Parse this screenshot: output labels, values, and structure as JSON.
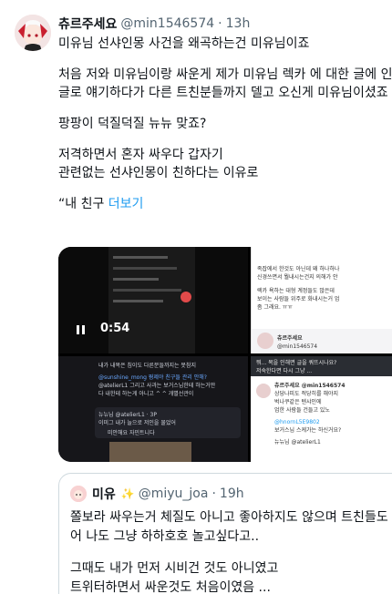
{
  "tweet": {
    "author_name": "츄르주세요",
    "author_handle": "@min1546574",
    "separator": "·",
    "time": "13h",
    "lines": [
      "미유님 선샤인몽 사건을 왜곡하는건 미유님이죠",
      "처음 저와 미유님이랑 싸운게 제가 미유님 렉카 에 대한 글에 인용",
      "글로 얘기하다가 다른 트친분들까지 델고 오신게 미유님이셨죠",
      "팡팡이 덕질덕질 뉴뉴 맞죠?",
      "저격하면서 혼자 싸우다 갑자기",
      "관련없는 선샤인몽이 친하다는 이유로"
    ],
    "last_line_prefix": "“내 친구 ",
    "last_line_mention": "더보기"
  },
  "media": {
    "video_duration": "0:54",
    "panel_top_right": [
      "족잡에서 한것도 아닌데 왜 하나하나",
      "신경쓰면서 뭘내시는건지 의해가 안",
      "렉카 욕하는 대형 계정들도 많은데",
      "보이는 사람들 위주로 화내시는거 엄",
      "좀 그래요. ㅠㅠ"
    ],
    "panel_top_right_name": "츄르주세요",
    "panel_top_right_handle": "@min1546574",
    "panel_bottom_left": [
      "내가 내목은 침이도 다른분들까지는 못참지",
      "@sunshine_mong 뭥제야 친구들 관리 안해?",
      "@atelierL1 그리고 사과는 보거스님한테 하는거만",
      "다 내한테 하는게 아니고 ^ ^ 개별선관이"
    ],
    "panel_bottom_left_reply": "뉴뉴님 @atelierL1 · 3P",
    "panel_bottom_left_reply_text": "이미그 내가 늘으로 저인을 물었어",
    "panel_bottom_left_note": "미안해요 자민트니다",
    "panel_bottom_right": [
      "뭐... 목을 인해면 글을 쿼뜨시나요?",
      "저숙한다면 다시 그냥 ...",
      "츄르주세요 @min1546574",
      "상당나피도 적당히를 해야지",
      "벅나쿠같은 텐샤인에",
      "엄한 사람들 건들고 있노",
      "@hnornL5E9802",
      "보거스님 스케가는 하신거요?",
      "뉴뉴님 @atelierL1"
    ]
  },
  "quote": {
    "author_name": "미유",
    "author_handle": "@miyu_joa",
    "separator": "·",
    "time": "19h",
    "lines": [
      "쫄보라 싸우는거 체질도 아니고 좋아하지도 않으며 트친들도 싫",
      "어 나도 그냥 하하호호 놀고싶다고..",
      "그때도 내가 먼저 시비건 것도 아니였고",
      "트위터하면서 싸운것도 처음이였음 ..."
    ]
  }
}
